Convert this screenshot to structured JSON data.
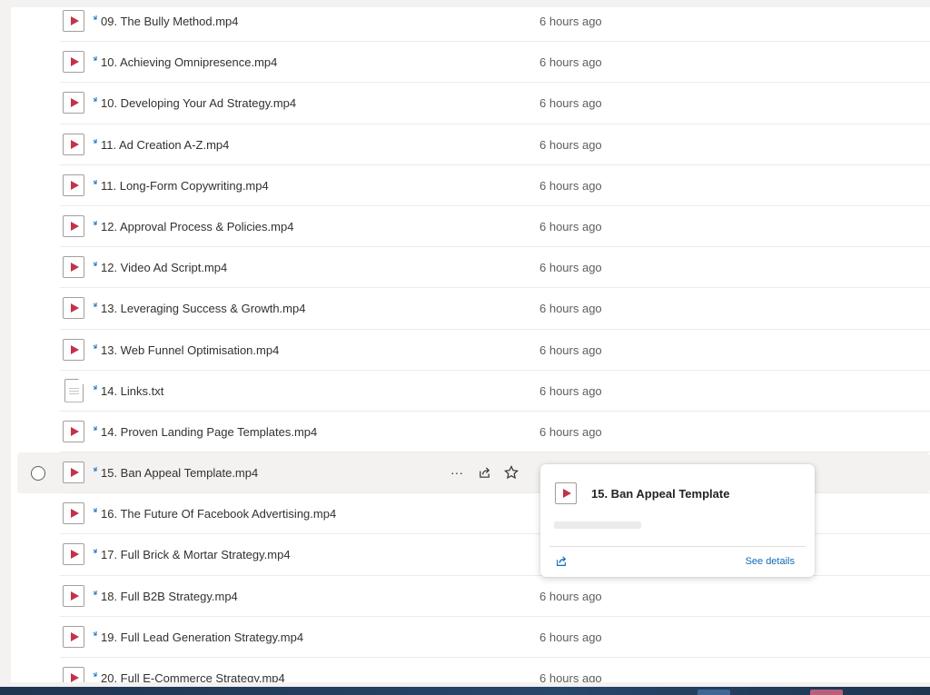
{
  "files": [
    {
      "name": "09. The Bully Method.mp4",
      "modified": "6 hours ago",
      "type": "video"
    },
    {
      "name": "10. Achieving Omnipresence.mp4",
      "modified": "6 hours ago",
      "type": "video"
    },
    {
      "name": "10. Developing Your Ad Strategy.mp4",
      "modified": "6 hours ago",
      "type": "video"
    },
    {
      "name": "11. Ad Creation A-Z.mp4",
      "modified": "6 hours ago",
      "type": "video"
    },
    {
      "name": "11. Long-Form Copywriting.mp4",
      "modified": "6 hours ago",
      "type": "video"
    },
    {
      "name": "12. Approval Process & Policies.mp4",
      "modified": "6 hours ago",
      "type": "video"
    },
    {
      "name": "12. Video Ad Script.mp4",
      "modified": "6 hours ago",
      "type": "video"
    },
    {
      "name": "13. Leveraging Success & Growth.mp4",
      "modified": "6 hours ago",
      "type": "video"
    },
    {
      "name": "13. Web Funnel Optimisation.mp4",
      "modified": "6 hours ago",
      "type": "video"
    },
    {
      "name": "14. Links.txt",
      "modified": "6 hours ago",
      "type": "text"
    },
    {
      "name": "14. Proven Landing Page Templates.mp4",
      "modified": "6 hours ago",
      "type": "video"
    },
    {
      "name": "15. Ban Appeal Template.mp4",
      "modified": "",
      "type": "video",
      "hovered": true
    },
    {
      "name": "16. The Future Of Facebook Advertising.mp4",
      "modified": "",
      "type": "video"
    },
    {
      "name": "17. Full Brick & Mortar Strategy.mp4",
      "modified": "",
      "type": "video"
    },
    {
      "name": "18. Full B2B Strategy.mp4",
      "modified": "6 hours ago",
      "type": "video"
    },
    {
      "name": "19. Full Lead Generation Strategy.mp4",
      "modified": "6 hours ago",
      "type": "video"
    },
    {
      "name": "20. Full E-Commerce Strategy.mp4",
      "modified": "6 hours ago",
      "type": "video"
    }
  ],
  "row_actions": {
    "more_icon": "more-horizontal-icon",
    "more_glyph": "···",
    "share_icon": "share-icon",
    "favorite_icon": "star-icon"
  },
  "hover_card": {
    "title": "15. Ban Appeal Template",
    "see_details": "See details",
    "share_icon": "share-icon"
  },
  "colors": {
    "video_play": "#c4314b",
    "accent": "#0f6cbd",
    "sync": "#0f6cbd"
  }
}
